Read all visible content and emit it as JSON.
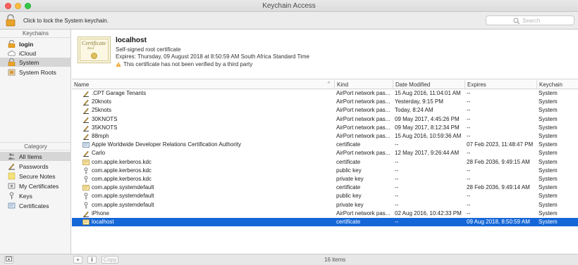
{
  "window": {
    "title": "Keychain Access"
  },
  "toolbar": {
    "lock_label": "Click to lock the System keychain.",
    "search_placeholder": "Search"
  },
  "sidebar": {
    "keychains_header": "Keychains",
    "keychains": [
      {
        "label": "login",
        "icon": "lock-icon"
      },
      {
        "label": "iCloud",
        "icon": "cloud-icon"
      },
      {
        "label": "System",
        "icon": "lock-icon",
        "selected": true
      },
      {
        "label": "System Roots",
        "icon": "folder-icon"
      }
    ],
    "category_header": "Category",
    "categories": [
      {
        "label": "All Items",
        "icon": "people-icon",
        "selected": true
      },
      {
        "label": "Passwords",
        "icon": "pen-icon"
      },
      {
        "label": "Secure Notes",
        "icon": "note-icon"
      },
      {
        "label": "My Certificates",
        "icon": "my-cert-icon"
      },
      {
        "label": "Keys",
        "icon": "key-icon"
      },
      {
        "label": "Certificates",
        "icon": "certificate-icon"
      }
    ]
  },
  "detail": {
    "thumb_word": "Certificate",
    "thumb_sub": "Root",
    "name": "localhost",
    "subtitle": "Self-signed root certificate",
    "expires": "Expires: Thursday, 09 August 2018 at 8:50:59 AM South Africa Standard Time",
    "warning": "This certificate has not been verified by a third party"
  },
  "table": {
    "columns": [
      "Name",
      "Kind",
      "Date Modified",
      "Expires",
      "Keychain"
    ],
    "rows": [
      {
        "icon": "pen-icon",
        "name": ".CPT Garage Tenants",
        "kind": "AirPort network pas...",
        "date": "15 Aug 2016, 11:04:01 AM",
        "expires": "--",
        "keychain": "System"
      },
      {
        "icon": "pen-icon",
        "name": "20knots",
        "kind": "AirPort network pas...",
        "date": "Yesterday, 9:15 PM",
        "expires": "--",
        "keychain": "System"
      },
      {
        "icon": "pen-icon",
        "name": "25knots",
        "kind": "AirPort network pas...",
        "date": "Today, 8:24 AM",
        "expires": "--",
        "keychain": "System"
      },
      {
        "icon": "pen-icon",
        "name": "30KNOTS",
        "kind": "AirPort network pas...",
        "date": "09 May 2017, 4:45:26 PM",
        "expires": "--",
        "keychain": "System"
      },
      {
        "icon": "pen-icon",
        "name": "35KNOTS",
        "kind": "AirPort network pas...",
        "date": "09 May 2017, 8:12:34 PM",
        "expires": "--",
        "keychain": "System"
      },
      {
        "icon": "pen-icon",
        "name": "88mph",
        "kind": "AirPort network pas...",
        "date": "15 Aug 2016, 10:59:36 AM",
        "expires": "--",
        "keychain": "System"
      },
      {
        "icon": "certificate-icon",
        "name": "Apple Worldwide Developer Relations Certification Authority",
        "kind": "certificate",
        "date": "--",
        "expires": "07 Feb 2023, 11:48:47 PM",
        "keychain": "System"
      },
      {
        "icon": "pen-icon",
        "name": "Carlo",
        "kind": "AirPort network pas...",
        "date": "12 May 2017, 9:26:44 AM",
        "expires": "--",
        "keychain": "System"
      },
      {
        "icon": "cert-gold-icon",
        "name": "com.apple.kerberos.kdc",
        "kind": "certificate",
        "date": "--",
        "expires": "28 Feb 2036, 9:49:15 AM",
        "keychain": "System"
      },
      {
        "icon": "key-icon",
        "name": "com.apple.kerberos.kdc",
        "kind": "public key",
        "date": "--",
        "expires": "--",
        "keychain": "System"
      },
      {
        "icon": "key-icon",
        "name": "com.apple.kerberos.kdc",
        "kind": "private key",
        "date": "--",
        "expires": "--",
        "keychain": "System"
      },
      {
        "icon": "cert-gold-icon",
        "name": "com.apple.systemdefault",
        "kind": "certificate",
        "date": "--",
        "expires": "28 Feb 2036, 9:49:14 AM",
        "keychain": "System"
      },
      {
        "icon": "key-icon",
        "name": "com.apple.systemdefault",
        "kind": "public key",
        "date": "--",
        "expires": "--",
        "keychain": "System"
      },
      {
        "icon": "key-icon",
        "name": "com.apple.systemdefault",
        "kind": "private key",
        "date": "--",
        "expires": "--",
        "keychain": "System"
      },
      {
        "icon": "pen-icon",
        "name": "iPhone",
        "kind": "AirPort network pas...",
        "date": "02 Aug 2016, 10:42:33 PM",
        "expires": "--",
        "keychain": "System"
      },
      {
        "icon": "cert-gold-icon",
        "name": "localhost",
        "kind": "certificate",
        "date": "--",
        "expires": "09 Aug 2018, 8:50:59 AM",
        "keychain": "System",
        "selected": true
      }
    ]
  },
  "bottom": {
    "add_label": "+",
    "info_label": "i",
    "copy_label": "Copy",
    "count": "16 items"
  },
  "colors": {
    "selection": "#1567d7",
    "sidebar_selection": "#d6d6d6"
  }
}
